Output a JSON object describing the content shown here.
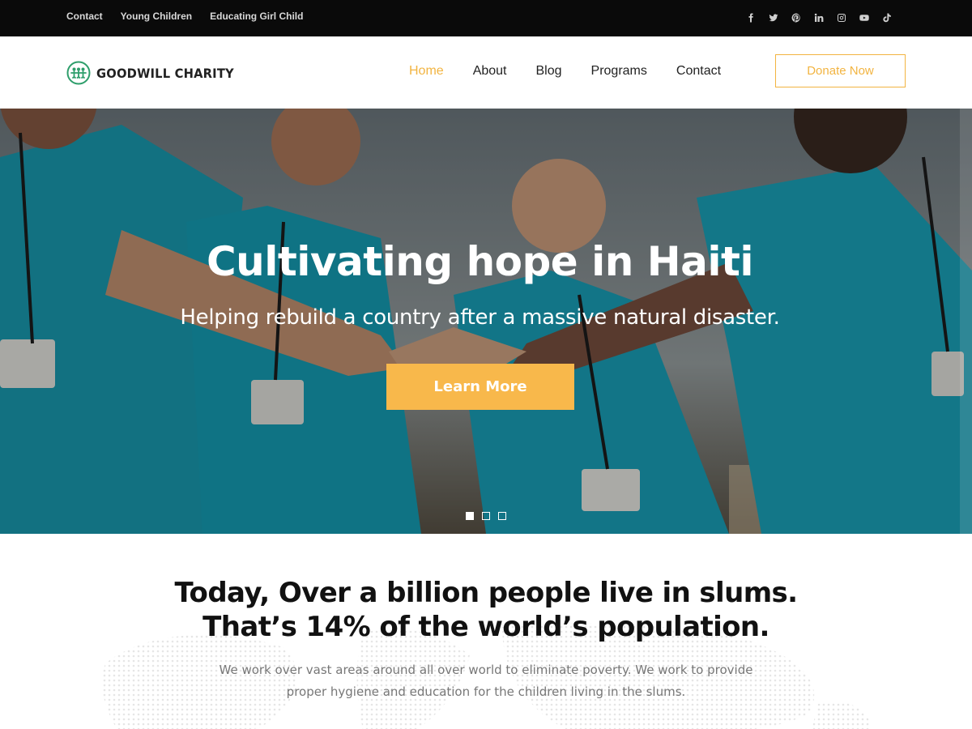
{
  "topbar": {
    "links": [
      "Contact",
      "Young Children",
      "Educating Girl Child"
    ],
    "socials": [
      "facebook-icon",
      "twitter-icon",
      "pinterest-icon",
      "linkedin-icon",
      "instagram-icon",
      "youtube-icon",
      "tiktok-icon"
    ]
  },
  "header": {
    "logo_text": "GOODWILL CHARITY",
    "nav": [
      "Home",
      "About",
      "Blog",
      "Programs",
      "Contact"
    ],
    "active_nav": "Home",
    "donate_label": "Donate Now"
  },
  "hero": {
    "title": "Cultivating hope in Haiti",
    "subtitle": "Helping rebuild a country after a massive natural disaster.",
    "cta_label": "Learn More",
    "slides": 3,
    "active_slide": 1
  },
  "stats": {
    "heading_line1": "Today, Over a billion people live in slums.",
    "heading_line2": "That’s 14% of the world’s population.",
    "body_line1": "We work over vast areas around all over world to eliminate poverty. We work to provide",
    "body_line2": "proper hygiene and education for the children living in the slums."
  },
  "colors": {
    "accent": "#f2b441",
    "cta": "#f8b84b",
    "topbar_bg": "#0a0a0a",
    "logo_green": "#2e9e6b"
  }
}
